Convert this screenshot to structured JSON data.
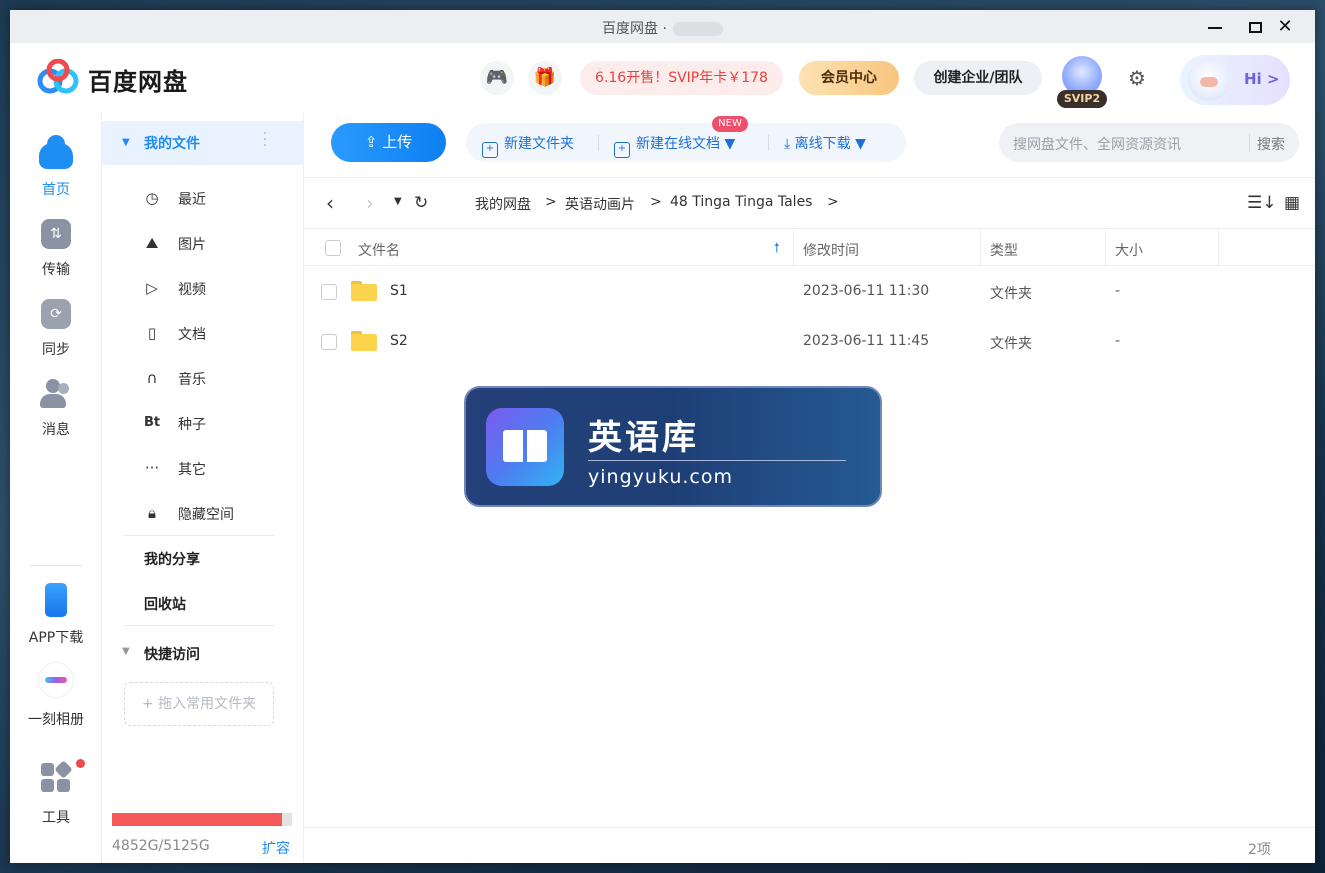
{
  "window": {
    "title": "百度网盘 ·"
  },
  "header": {
    "logo_text": "百度网盘",
    "promo": "6.16开售！SVIP年卡￥178",
    "vip_center": "会员中心",
    "team": "创建企业/团队",
    "svip_badge": "SVIP2",
    "hi": "Hi >"
  },
  "leftnav": {
    "home": "首页",
    "transfer": "传输",
    "sync": "同步",
    "messages": "消息",
    "app_download": "APP下载",
    "moment_album": "一刻相册",
    "tools": "工具"
  },
  "sidebar": {
    "my_files": "我的文件",
    "items": [
      {
        "label": "最近",
        "icon": "clock-icon"
      },
      {
        "label": "图片",
        "icon": "image-icon"
      },
      {
        "label": "视频",
        "icon": "play-icon"
      },
      {
        "label": "文档",
        "icon": "document-icon"
      },
      {
        "label": "音乐",
        "icon": "headphones-icon"
      },
      {
        "label": "种子",
        "icon": "bt-icon"
      },
      {
        "label": "其它",
        "icon": "more-icon"
      },
      {
        "label": "隐藏空间",
        "icon": "lock-icon"
      }
    ],
    "my_share": "我的分享",
    "recycle": "回收站",
    "quick_access": "快捷访问",
    "drop_hint": "+ 拖入常用文件夹",
    "quota_text": "4852G/5125G",
    "quota_used_fraction": 0.9467,
    "expand": "扩容"
  },
  "toolbar": {
    "upload": "上传",
    "new_folder": "新建文件夹",
    "new_doc": "新建在线文档",
    "new_badge": "NEW",
    "offline_download": "离线下载",
    "search_placeholder": "搜网盘文件、全网资源资讯",
    "search_button": "搜索"
  },
  "breadcrumb": [
    "我的网盘",
    "英语动画片",
    "48 Tinga Tinga Tales"
  ],
  "breadcrumb_sep": ">",
  "table": {
    "columns": [
      "文件名",
      "修改时间",
      "类型",
      "大小"
    ],
    "rows": [
      {
        "name": "S1",
        "modified": "2023-06-11 11:30",
        "type": "文件夹",
        "size": "-"
      },
      {
        "name": "S2",
        "modified": "2023-06-11 11:45",
        "type": "文件夹",
        "size": "-"
      }
    ]
  },
  "watermark": {
    "title": "英语库",
    "url": "yingyuku.com"
  },
  "status": {
    "count": "2项"
  },
  "colors": {
    "accent": "#1f8cf5",
    "quota": "#f55a5a",
    "promo_text": "#e9423d"
  }
}
